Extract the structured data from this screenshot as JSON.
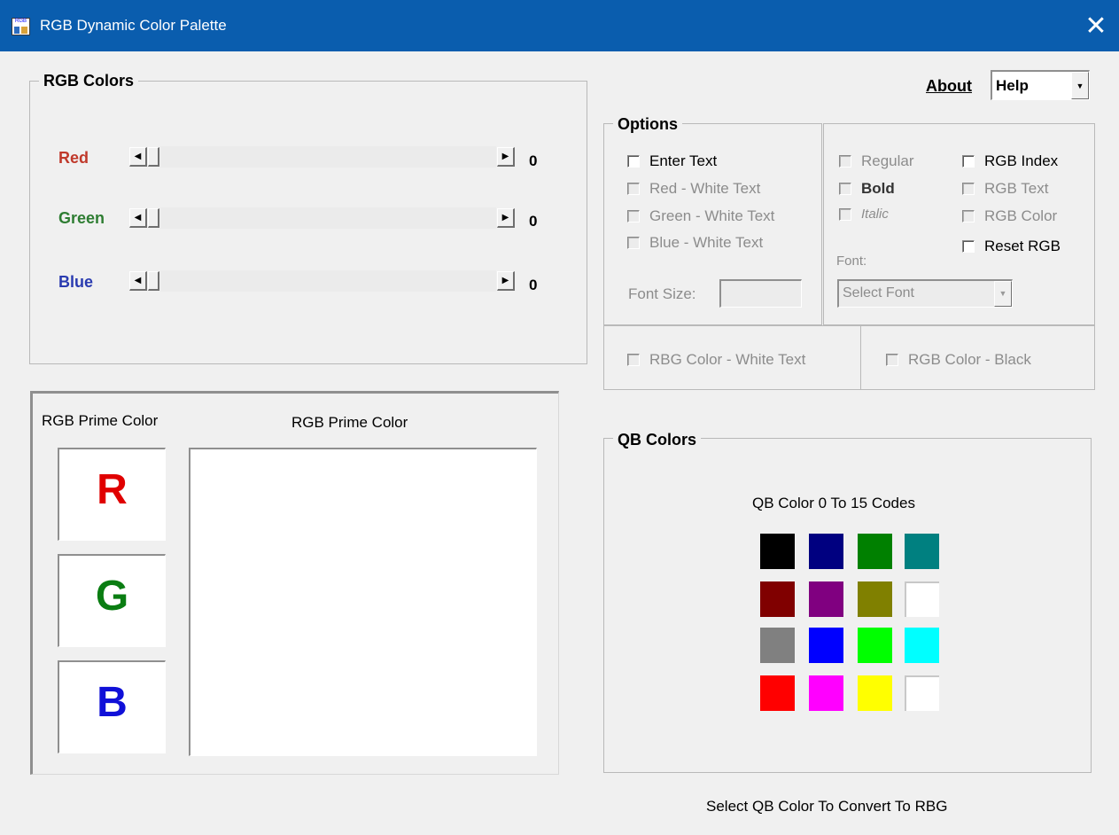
{
  "window": {
    "title": "RGB Dynamic Color Palette",
    "close_glyph": "✕",
    "icon_text": "RGB"
  },
  "rgb_colors": {
    "legend": "RGB Colors",
    "sliders": [
      {
        "label": "Red",
        "value": "0",
        "color": "#c0392b"
      },
      {
        "label": "Green",
        "value": "0",
        "color": "#2e7d32"
      },
      {
        "label": "Blue",
        "value": "0",
        "color": "#2a3bb0"
      }
    ],
    "arrow_left": "◀",
    "arrow_right": "▶"
  },
  "menu": {
    "about": "About",
    "help_value": "Help",
    "dropdown_arrow": "▼"
  },
  "options": {
    "legend": "Options",
    "enter_text": "Enter Text",
    "red_white": "Red - White Text",
    "green_white": "Green - White Text",
    "blue_white": "Blue - White Text",
    "font_size_label": "Font Size:",
    "regular": "Regular",
    "bold": "Bold",
    "italic": "Italic",
    "rgb_index": "RGB Index",
    "rgb_text": "RGB Text",
    "rgb_color": "RGB Color",
    "reset_rgb": "Reset RGB",
    "font_label": "Font:",
    "font_select_placeholder": "Select Font",
    "rbg_color_white": "RBG Color - White Text",
    "rgb_color_black": "RGB Color - Black"
  },
  "prime": {
    "left_title": "RGB Prime Color",
    "right_title": "RGB Prime Color",
    "letters": [
      {
        "letter": "R",
        "color": "#e00000"
      },
      {
        "letter": "G",
        "color": "#0a7d12"
      },
      {
        "letter": "B",
        "color": "#1010d8"
      }
    ]
  },
  "qb_colors": {
    "legend": "QB Colors",
    "caption": "QB Color 0 To 15 Codes",
    "swatches": [
      "#000000",
      "#000080",
      "#008000",
      "#008080",
      "#800000",
      "#800080",
      "#808000",
      "#ffffff",
      "#808080",
      "#0000ff",
      "#00ff00",
      "#00ffff",
      "#ff0000",
      "#ff00ff",
      "#ffff00",
      "#ffffff"
    ]
  },
  "footer": {
    "hint": "Select QB Color To Convert To RBG"
  }
}
